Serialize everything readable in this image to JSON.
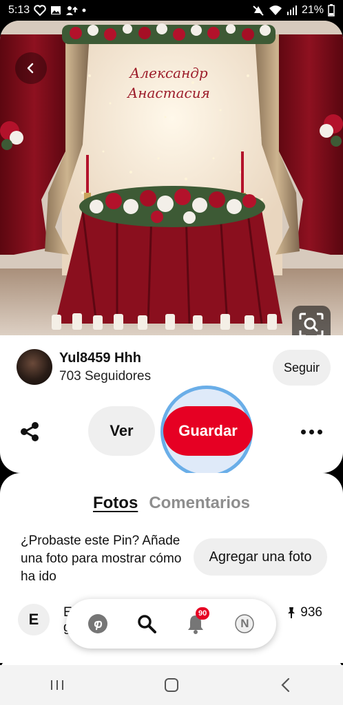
{
  "status_bar": {
    "time": "5:13",
    "battery": "21%",
    "left_icons": [
      "heart-message-icon",
      "gallery-icon",
      "person-upload-icon",
      "dot-icon"
    ],
    "right_icons": [
      "mute-icon",
      "wifi-icon",
      "signal-icon",
      "battery-icon"
    ]
  },
  "pin": {
    "image_text_line1": "Александр",
    "image_text_line2": "Анастасия"
  },
  "creator": {
    "name": "Yul8459 Hhh",
    "followers": "703 Seguidores",
    "follow_label": "Seguir"
  },
  "actions": {
    "view_label": "Ver",
    "save_label": "Guardar"
  },
  "tried": {
    "tab_photos": "Fotos",
    "tab_comments": "Comentarios",
    "prompt": "¿Probaste este Pin? Añade una foto para mostrar cómo ha ido",
    "add_photo_label": "Agregar una foto"
  },
  "comment": {
    "avatar_letter": "E",
    "text_line1": "E",
    "text_line2": "g",
    "count": "936"
  },
  "nav": {
    "notifications_badge": "90",
    "profile_letter": "N"
  },
  "colors": {
    "brand_red": "#e60023",
    "highlight_ring": "#6aaee8"
  }
}
